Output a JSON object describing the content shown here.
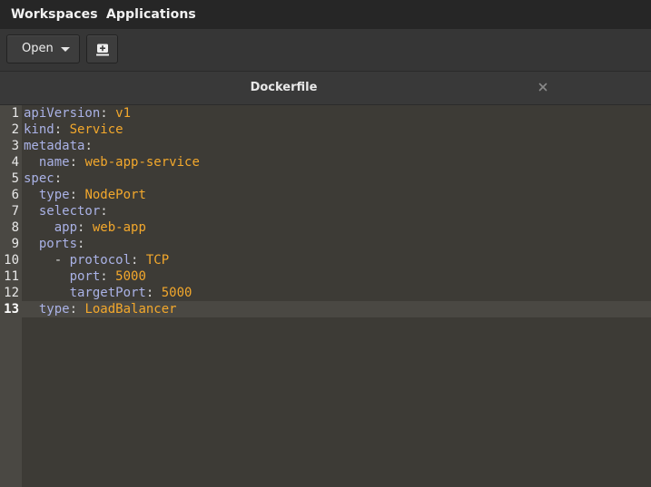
{
  "menubar": {
    "workspaces_label": "Workspaces",
    "applications_label": "Applications"
  },
  "toolbar": {
    "open_label": "Open",
    "open_dropdown_icon": "chevron-down-icon",
    "new_document_icon": "new-document-icon"
  },
  "tab": {
    "title": "Dockerfile",
    "close_icon": "close-icon"
  },
  "editor": {
    "current_line": 13,
    "colors": {
      "key": "#aab2e6",
      "value": "#f3a82c",
      "punctuation": "#d8d8d8",
      "background": "#3d3b36",
      "gutter": "#4a4843"
    },
    "lines": [
      {
        "n": "1",
        "indent": "",
        "key": "apiVersion",
        "sep": ": ",
        "value": "v1"
      },
      {
        "n": "2",
        "indent": "",
        "key": "kind",
        "sep": ": ",
        "value": "Service"
      },
      {
        "n": "3",
        "indent": "",
        "key": "metadata",
        "sep": ":",
        "value": ""
      },
      {
        "n": "4",
        "indent": "  ",
        "key": "name",
        "sep": ": ",
        "value": "web-app-service"
      },
      {
        "n": "5",
        "indent": "",
        "key": "spec",
        "sep": ":",
        "value": ""
      },
      {
        "n": "6",
        "indent": "  ",
        "key": "type",
        "sep": ": ",
        "value": "NodePort"
      },
      {
        "n": "7",
        "indent": "  ",
        "key": "selector",
        "sep": ":",
        "value": ""
      },
      {
        "n": "8",
        "indent": "    ",
        "key": "app",
        "sep": ": ",
        "value": "web-app"
      },
      {
        "n": "9",
        "indent": "  ",
        "key": "ports",
        "sep": ":",
        "value": ""
      },
      {
        "n": "10",
        "indent": "    - ",
        "key": "protocol",
        "sep": ": ",
        "value": "TCP"
      },
      {
        "n": "11",
        "indent": "      ",
        "key": "port",
        "sep": ": ",
        "value": "5000"
      },
      {
        "n": "12",
        "indent": "      ",
        "key": "targetPort",
        "sep": ": ",
        "value": "5000"
      },
      {
        "n": "13",
        "indent": "  ",
        "key": "type",
        "sep": ": ",
        "value": "LoadBalancer"
      }
    ]
  }
}
